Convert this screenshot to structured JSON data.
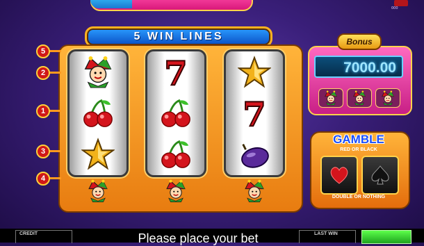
{
  "banner": {
    "title": "5 WIN LINES"
  },
  "paylines": {
    "markers": [
      "5",
      "2",
      "1",
      "3",
      "4"
    ]
  },
  "reels": [
    {
      "symbols": [
        "jester",
        "cherries",
        "star"
      ],
      "bottom": "jester"
    },
    {
      "symbols": [
        "seven",
        "cherries",
        "cherries"
      ],
      "bottom": "jester"
    },
    {
      "symbols": [
        "star",
        "seven",
        "plum"
      ],
      "bottom": "jester"
    }
  ],
  "symbol_glyphs": {
    "seven": "7"
  },
  "bonus": {
    "label": "Bonus",
    "amount": "7000.00"
  },
  "gamble": {
    "title": "GAMBLE",
    "subtitle": "RED OR BLACK",
    "footer": "DOUBLE OR NOTHING"
  },
  "bottom_bar": {
    "credit_label": "CREDIT",
    "message": "Please place your bet",
    "last_win_label": "LAST WIN"
  },
  "colors": {
    "accent": "#ffb21f",
    "background": "#3a1f7a",
    "display_text": "#9fe6ff"
  }
}
